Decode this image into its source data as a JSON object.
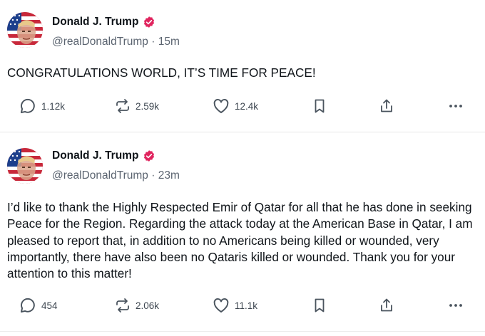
{
  "posts": [
    {
      "author": "Donald J. Trump",
      "handle": "@realDonaldTrump",
      "separator": "·",
      "time": "15m",
      "text": "CONGRATULATIONS WORLD, IT’S TIME FOR PEACE!",
      "replies": "1.12k",
      "reposts": "2.59k",
      "likes": "12.4k"
    },
    {
      "author": "Donald J. Trump",
      "handle": "@realDonaldTrump",
      "separator": "·",
      "time": "23m",
      "text": "I’d like to thank the Highly Respected Emir of Qatar for all that he has done in seeking Peace for the Region. Regarding the attack today at the American Base in Qatar, I am pleased to report that, in addition to no Americans being killed or wounded, very importantly, there have also been no Qataris killed or wounded. Thank you for your attention to this matter!",
      "replies": "454",
      "reposts": "2.06k",
      "likes": "11.1k"
    }
  ],
  "icons": {
    "verified": "verified-badge-icon",
    "reply": "reply-bubble-icon",
    "repost": "repost-arrows-icon",
    "like": "heart-icon",
    "bookmark": "bookmark-icon",
    "share": "share-upload-icon",
    "more": "more-dots-icon"
  },
  "colors": {
    "verified_badge": "#e0245e",
    "text": "#0f1419",
    "secondary_text": "#5b6470",
    "icon": "#4a545e",
    "divider": "#e7e7e7"
  }
}
